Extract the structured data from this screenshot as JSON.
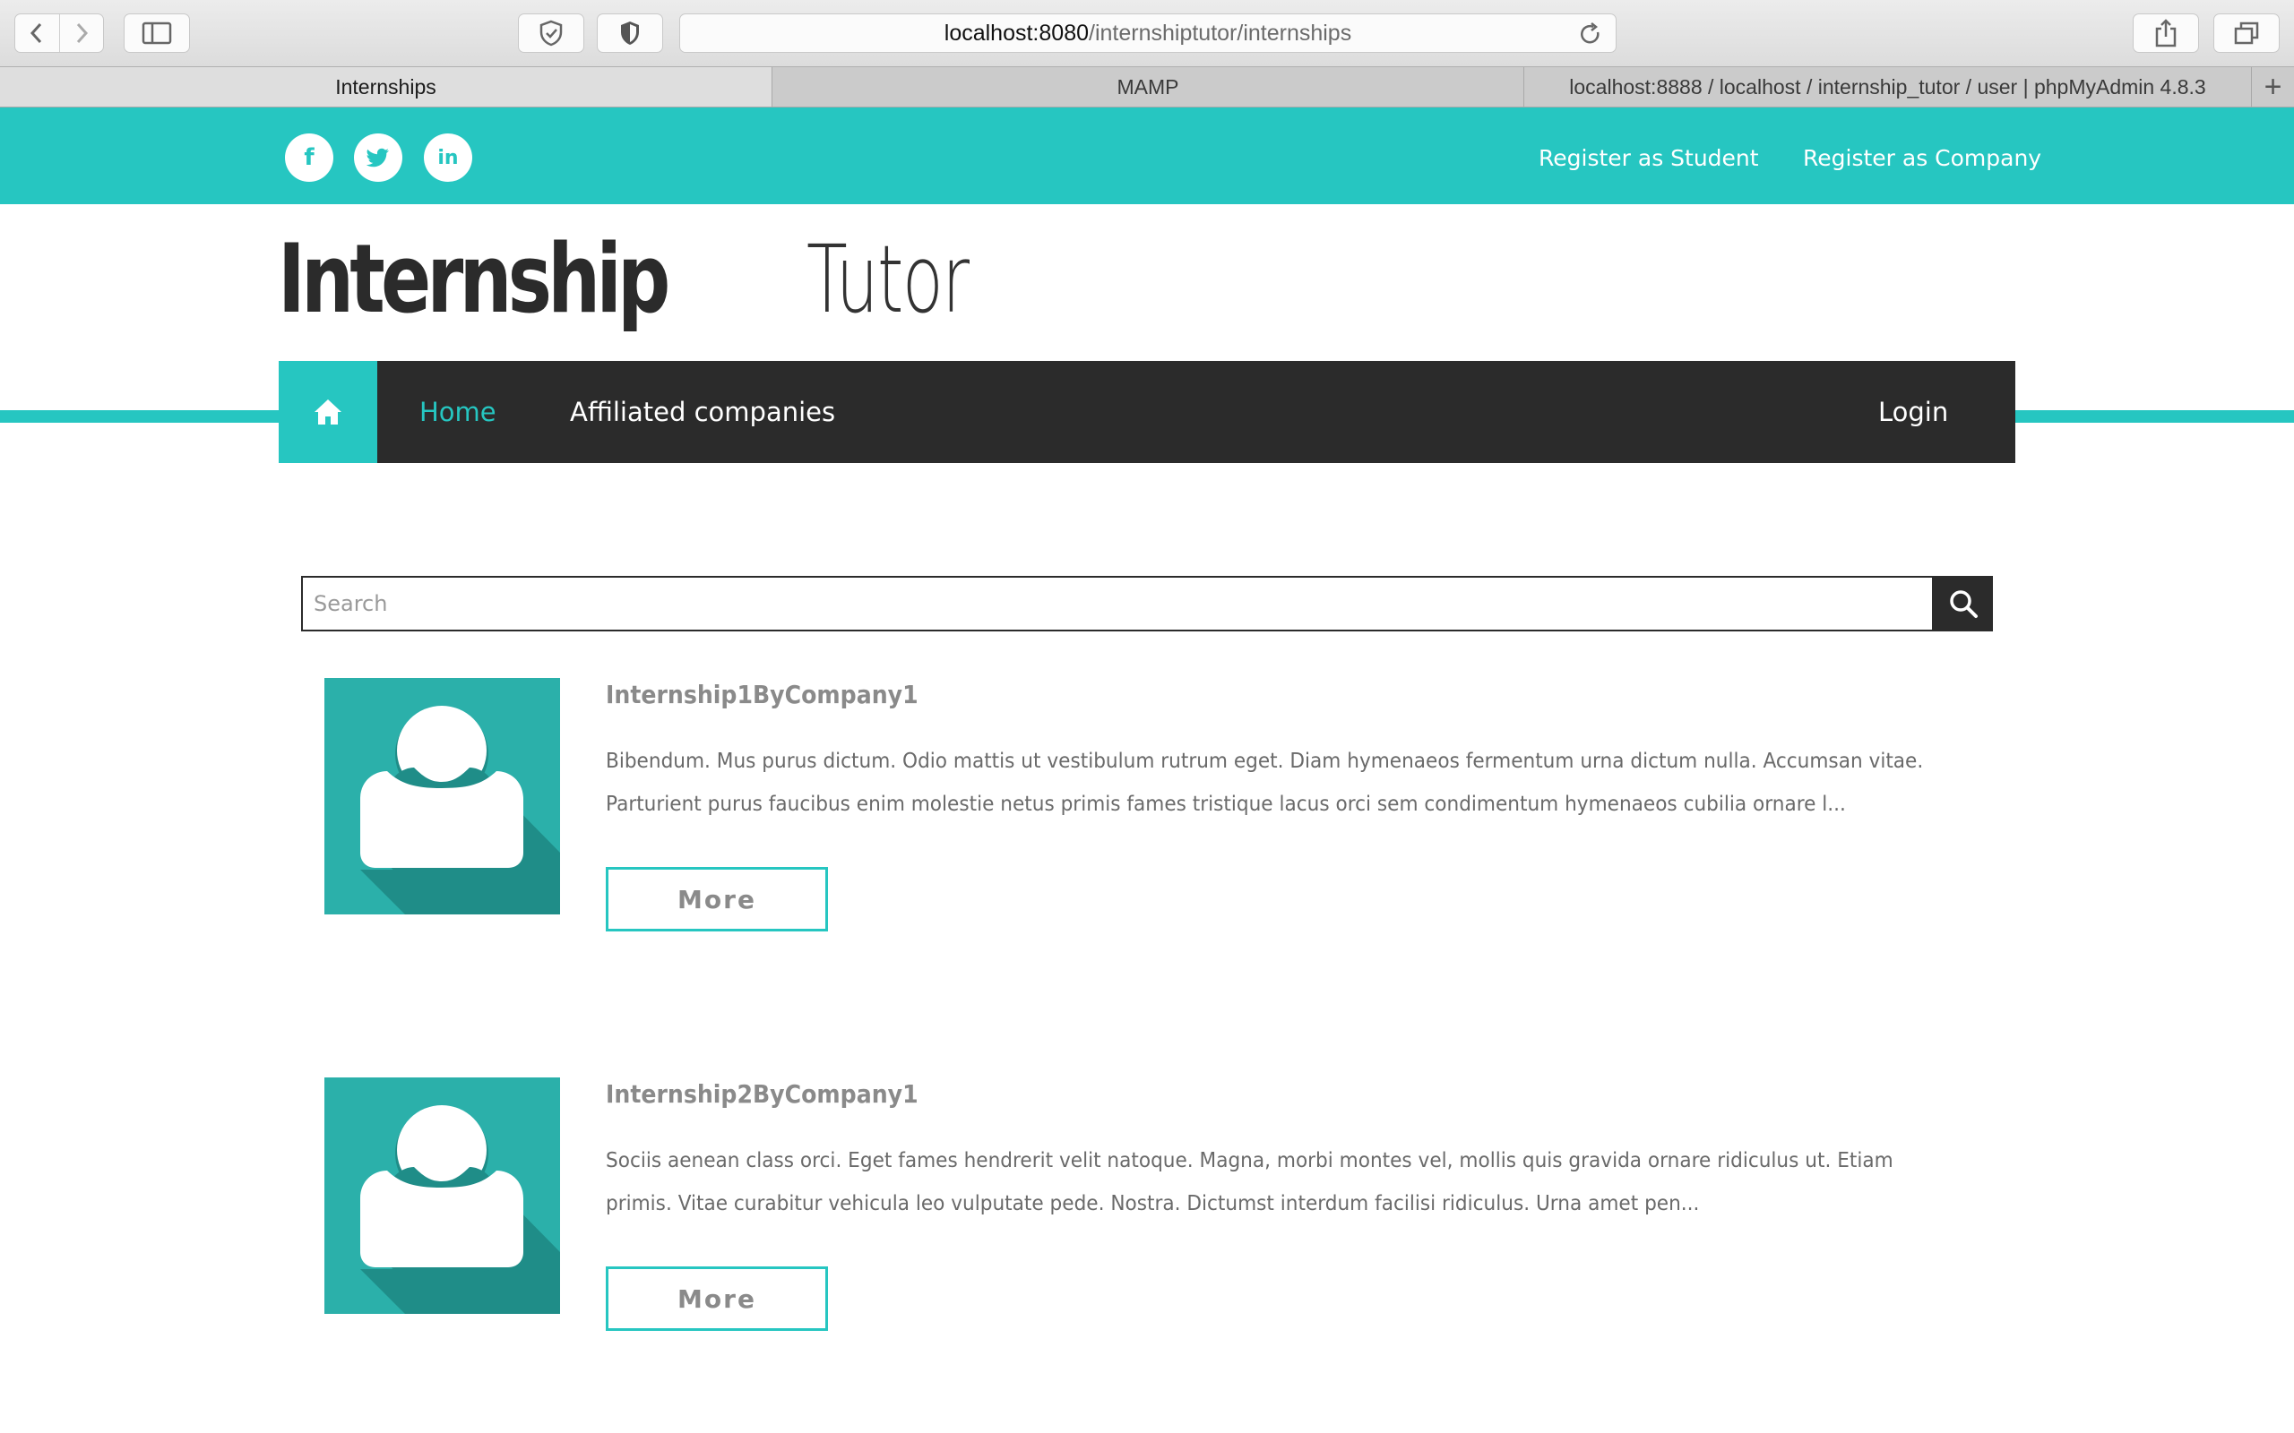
{
  "browser": {
    "url_host": "localhost:8080",
    "url_path": "/internshiptutor/internships",
    "tabs": [
      {
        "label": "Internships"
      },
      {
        "label": "MAMP"
      },
      {
        "label": "localhost:8888 / localhost / internship_tutor / user | phpMyAdmin 4.8.3"
      }
    ],
    "new_tab_label": "+"
  },
  "topbar": {
    "social": [
      {
        "icon": "facebook-icon",
        "glyph": "f"
      },
      {
        "icon": "twitter-icon",
        "glyph": "t"
      },
      {
        "icon": "linkedin-icon",
        "glyph": "in"
      }
    ],
    "register_student": "Register as Student",
    "register_company": "Register as Company"
  },
  "logo": {
    "bold": "Internship",
    "light": "Tutor"
  },
  "nav": {
    "home": "Home",
    "affiliated": "Affiliated companies",
    "login": "Login"
  },
  "search": {
    "placeholder": "Search"
  },
  "internships": [
    {
      "title": "Internship1ByCompany1",
      "line1": "Bibendum. Mus purus dictum. Odio mattis ut vestibulum rutrum eget. Diam hymenaeos fermentum urna dictum nulla. Accumsan vitae.",
      "line2": "Parturient purus faucibus enim molestie netus primis fames tristique lacus orci sem condimentum hymenaeos cubilia ornare l...",
      "more": "More"
    },
    {
      "title": "Internship2ByCompany1",
      "line1": "Sociis aenean class orci. Eget fames hendrerit velit natoque. Magna, morbi montes vel, mollis quis gravida ornare ridiculus ut. Etiam",
      "line2": "primis. Vitae curabitur vehicula leo vulputate pede. Nostra. Dictumst interdum facilisi ridiculus. Urna amet pen...",
      "more": "More"
    }
  ],
  "colors": {
    "accent": "#26c6c1",
    "dark": "#2b2b2b",
    "avatar_bg": "#2bb0aa",
    "avatar_shadow": "#1f8d88"
  }
}
